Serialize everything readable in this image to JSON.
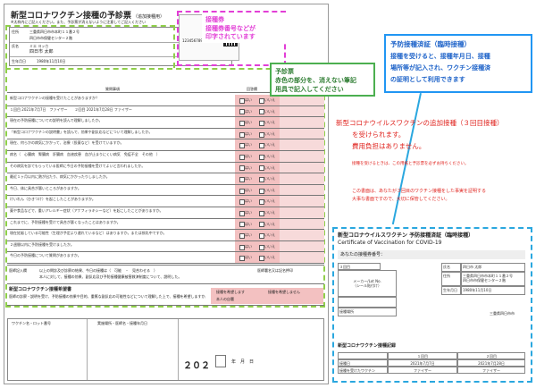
{
  "form": {
    "title": "新型コロナワクチン接種の予診票",
    "subtitle": "（追加接種用）",
    "top_note": "※太枠内にご記入ください。また、予診票が消えないように注意してご記入ください",
    "code": "1234567890",
    "address_label": "住所",
    "address_value": "三重県四日市市本町１１番２号",
    "name_label": "氏名",
    "name_kana": "ミエ ヨッカ",
    "name_value": "四日市 太郎",
    "birth_label": "生年月日",
    "birth_value": "1980年11月10日",
    "clinic_value": "四日市市保健センター２階",
    "column_yes": "はい",
    "column_no": "いいえ",
    "column_header_q": "質問事項",
    "column_header_a": "回答欄",
    "column_header_doc": "医師記入欄",
    "questions": [
      "新型コロナワクチンの接種を受けたことがありますか？",
      "１回目 2021年7月7日　ファイザー　　２回目 2021年7月28日 ファイザー",
      "現在の予防接種についての説明を読んで理解しましたか。",
      "「新型コロナワクチンの説明書」を読んで、効果や副反応などについて理解しましたか。",
      "現在、何らかの病気にかかって、治療（投薬など）を受けていますか。",
      "病名（　心臓病　腎臓病　肝臓病　血液疾患　血が止まりにくい病気　免疫不全　その他　）",
      "その病気を診てもらっている医師に今日の予防接種を受けてよいと言われましたか。",
      "最近１ヶ月以内に熱が出たり、病気にかかったりしましたか。",
      "今日、体に具合が悪いところがありますか。",
      "けいれん（ひきつけ）を起こしたことがありますか。",
      "薬や食品などで、重いアレルギー症状（アナフィラキシーなど）を起こしたことがありますか。",
      "これまでに、予防接種を受けて具合が悪くなったことはありますか。",
      "現在妊娠している可能性（生理が予定より遅れているなど）はありますか。または授乳中ですか。",
      "２週間以内に予防接種を受けましたか。",
      "今日の予防接種について質問がありますか。"
    ],
    "doctor_section_label": "医師記入欄",
    "doctor_text": "以上の問診及び診察の結果、今日の接種は（　可能　・　見合わせる　）",
    "doctor_note": "本人に対して、接種の効果、副反応及び予防接種健康被害救済制度について、説明した。",
    "doctor_sign": "医師署名又は記名押印",
    "consent_title": "新型コロナワクチン接種希望書",
    "consent_text": "医師の診察・説明を受け、予防接種の効果や目的、重篤な副反応の可能性などについて理解した上で、接種を希望しますか。",
    "consent_yes": "接種を希望します",
    "consent_no": "接種を希望しません",
    "consent_sign": "本人の自署",
    "stamp_lot": "ワクチン名・ロット番号",
    "stamp_place": "実施場所・医師名・接種年月日",
    "date_prefix": "２０２",
    "date_suffix": "年　月　日"
  },
  "sticker_callout": {
    "line1": "接種券",
    "line2": "接種券番号などが",
    "line3": "印字されています"
  },
  "pen_callout": {
    "line1": "予診票",
    "line2": "赤色の部分を、消えない筆記",
    "line3": "用具で記入してください"
  },
  "cert_callout": {
    "line1": "予防接種済証（臨時接種）",
    "line2": "接種を受けると、接種年月日、接種",
    "line3": "場所等が記入され、ワクチン接種済",
    "line4": "の証明として利用できます"
  },
  "notice": {
    "line1": "新型コロナウイルスワクチンの追加接種（３回目接種）",
    "line2": "を受けられます。",
    "line3": "費用負担はありません。",
    "small1": "接種を受けるときは、この用紙と予診票を必ずお持ちください。",
    "small2": "この書面は、あなたが３回目のワクチン接種をした事実を証明する",
    "small3": "大事な書面ですので、大切に保管してください。"
  },
  "certificate": {
    "title": "新型コロナウイルスワクチン 予防接種済証（臨時接種）",
    "title_en": "Certificate of Vaccination for COVID-19",
    "number_label": "あなたの接種券番号：",
    "dose_label": "３回目",
    "maker_label": "メーカー/Lot No.",
    "sticker_label": "（シール貼付け）",
    "date_label": "接種年月日",
    "vaccine_label": "ワクチン名",
    "place_label": "接種場所",
    "name_label": "氏名",
    "name_value": "四日市 太郎",
    "address_label": "住所",
    "address_value": "三重県四日市市本町１１番２号",
    "clinic_value": "四日市市保健センター２階",
    "birth_label": "生年月日",
    "birth_value": "1980年11月10日",
    "issuer": "三重県四日市市",
    "history_title": "新型コロナワクチン接種記録",
    "history_dose1": "１回目",
    "history_dose2": "２回目",
    "history_date_label": "接種日",
    "history_date1": "2021年7月7日",
    "history_date2": "2021年7月28日",
    "history_vaccine_label": "接種を受けたワクチン",
    "history_vaccine1": "ファイザー",
    "history_vaccine2": "ファイザー"
  },
  "colors": {
    "green_dash": "#8fcf4a",
    "magenta_dash": "#e23fd6",
    "blue_dash": "#2aa7df",
    "callout_green": "#4caf50",
    "callout_blue": "#2196f3",
    "notice_red": "#e0241f",
    "answer_pink": "#f3c1c1"
  },
  "icons": {
    "qr": "qr-code-icon"
  }
}
